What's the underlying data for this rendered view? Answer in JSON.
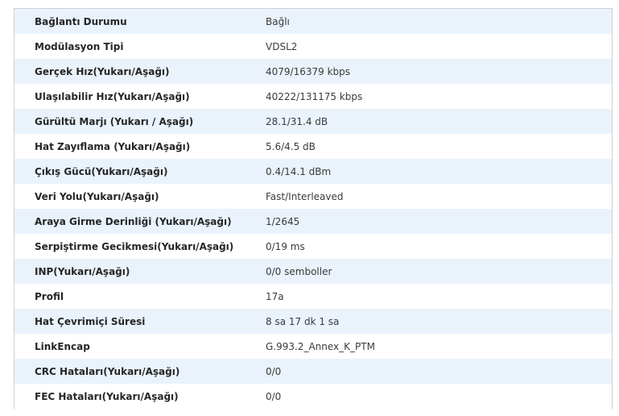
{
  "status_table": {
    "rows": [
      {
        "label": "Bağlantı Durumu",
        "value": "Bağlı"
      },
      {
        "label": "Modülasyon Tipi",
        "value": "VDSL2"
      },
      {
        "label": "Gerçek Hız(Yukarı/Aşağı)",
        "value": "4079/16379 kbps"
      },
      {
        "label": "Ulaşılabilir Hız(Yukarı/Aşağı)",
        "value": "40222/131175 kbps"
      },
      {
        "label": "Gürültü Marjı (Yukarı / Aşağı)",
        "value": "28.1/31.4 dB"
      },
      {
        "label": "Hat Zayıflama (Yukarı/Aşağı)",
        "value": "5.6/4.5 dB"
      },
      {
        "label": "Çıkış Gücü(Yukarı/Aşağı)",
        "value": "0.4/14.1 dBm"
      },
      {
        "label": "Veri Yolu(Yukarı/Aşağı)",
        "value": "Fast/Interleaved"
      },
      {
        "label": "Araya Girme Derinliği (Yukarı/Aşağı)",
        "value": "1/2645"
      },
      {
        "label": "Serpiştirme Gecikmesi(Yukarı/Aşağı)",
        "value": "0/19 ms"
      },
      {
        "label": "INP(Yukarı/Aşağı)",
        "value": "0/0 semboller"
      },
      {
        "label": "Profil",
        "value": "17a"
      },
      {
        "label": "Hat Çevrimiçi Süresi",
        "value": "8 sa 17 dk 1 sa"
      },
      {
        "label": "LinkEncap",
        "value": "G.993.2_Annex_K_PTM"
      },
      {
        "label": "CRC Hataları(Yukarı/Aşağı)",
        "value": "0/0"
      },
      {
        "label": "FEC Hataları(Yukarı/Aşağı)",
        "value": "0/0"
      }
    ]
  }
}
